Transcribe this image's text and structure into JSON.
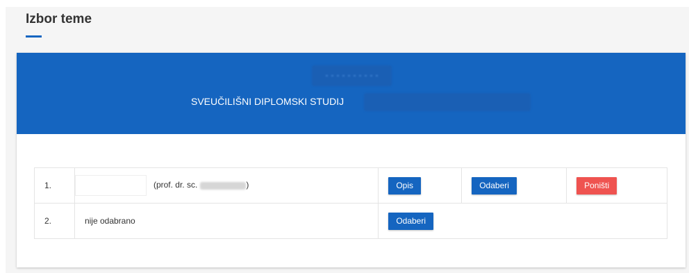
{
  "page": {
    "title": "Izbor teme"
  },
  "colors": {
    "accent": "#1565c0",
    "danger": "#ef5350"
  },
  "header": {
    "program_label": "SVEUČILIŠNI DIPLOMSKI STUDIJ"
  },
  "topics": [
    {
      "number": "1.",
      "mentor_prefix": "(prof. dr. sc.",
      "mentor_suffix": ")",
      "buttons": {
        "description": "Opis",
        "select": "Odaberi",
        "cancel": "Poništi"
      }
    },
    {
      "number": "2.",
      "status": "nije odabrano",
      "buttons": {
        "select": "Odaberi"
      }
    }
  ]
}
